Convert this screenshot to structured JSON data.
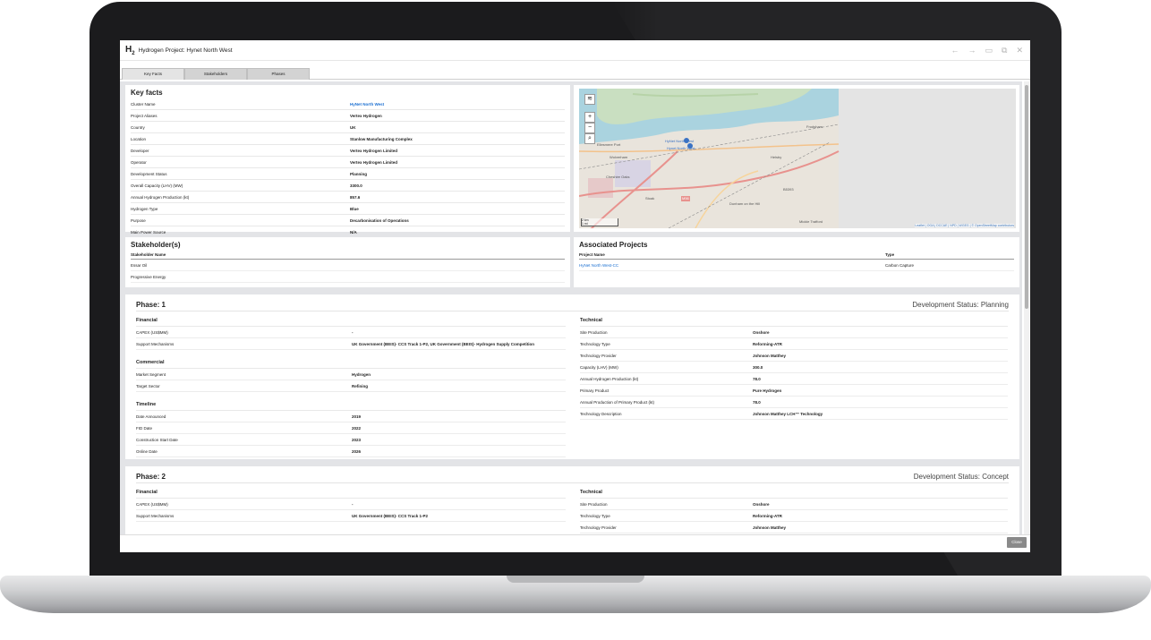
{
  "window": {
    "logo_text": "H",
    "logo_sub": "2",
    "title": "Hydrogen Project: Hynet North West"
  },
  "tabs": [
    "Key Facts",
    "Stakeholders",
    "Phases"
  ],
  "key_facts": {
    "heading": "Key facts",
    "rows": [
      {
        "k": "Cluster Name",
        "v": "HyNet North West"
      },
      {
        "k": "Project Aliases",
        "v": "Vertex Hydrogen"
      },
      {
        "k": "Country",
        "v": "UK"
      },
      {
        "k": "Location",
        "v": "Stanlow Manufacturing Complex"
      },
      {
        "k": "Developer",
        "v": "Vertex Hydrogen Limited"
      },
      {
        "k": "Operator",
        "v": "Vertex Hydrogen Limited"
      },
      {
        "k": "Development Status",
        "v": "Planning"
      },
      {
        "k": "Overall Capacity (LHV) (MW)",
        "v": "3300.0"
      },
      {
        "k": "Annual Hydrogen Production (kt)",
        "v": "857.6"
      },
      {
        "k": "Hydrogen Type",
        "v": "Blue"
      },
      {
        "k": "Purpose",
        "v": "Decarbonisation of Operations"
      },
      {
        "k": "Main Power Source",
        "v": "N/A"
      }
    ]
  },
  "map": {
    "labels": {
      "ellesmere": "Ellesmere Port",
      "hynet1": "HyNet North West",
      "hynet2": "Hynet North West",
      "wolverham": "Wolverham",
      "cheshire": "Cheshire Oaks",
      "frodsham": "Frodsham",
      "helsby": "Helsby",
      "stoak": "Stoak",
      "dunham": "Dunham on the Hill",
      "mickle": "Mickle Trafford",
      "m56": "M56",
      "b5393": "B5393"
    },
    "scale_km": "2 km",
    "scale_mi": "1 mi",
    "attribution": "Leaflet | OGA | DCCAE | NPD | WGEG | © OpenStreetMap contributors",
    "zoom_in": "+",
    "zoom_out": "−"
  },
  "stakeholders": {
    "heading": "Stakeholder(s)",
    "column": "Stakeholder Name",
    "rows": [
      "Essar Oil",
      "Progressive Energy"
    ]
  },
  "associated": {
    "heading": "Associated Projects",
    "col_name": "Project Name",
    "col_type": "Type",
    "rows": [
      {
        "name": "HyNet North West-CC",
        "type": "Carbon Capture"
      }
    ]
  },
  "phase1": {
    "title": "Phase: 1",
    "status": "Development Status: Planning",
    "financial_title": "Financial",
    "financial": [
      {
        "k": "CAPEX (US$MM)",
        "v": "-"
      },
      {
        "k": "Support Mechanisms",
        "v": "UK Government (BEIS)- CCS Track 1-P2, UK Government (BEIS)- Hydrogen Supply Competition"
      }
    ],
    "commercial_title": "Commercial",
    "commercial": [
      {
        "k": "Market Segment",
        "v": "Hydrogen"
      },
      {
        "k": "Target Sector",
        "v": "Refining"
      }
    ],
    "timeline_title": "Timeline",
    "timeline": [
      {
        "k": "Date Announced",
        "v": "2019"
      },
      {
        "k": "FID Date",
        "v": "2022"
      },
      {
        "k": "Construction Start Date",
        "v": "2023"
      },
      {
        "k": "Online Date",
        "v": "2026"
      }
    ],
    "technical_title": "Technical",
    "technical": [
      {
        "k": "Site Production",
        "v": "Onshore"
      },
      {
        "k": "Technology Type",
        "v": "Reforming-ATR"
      },
      {
        "k": "Technology Provider",
        "v": "Johnson Matthey"
      },
      {
        "k": "Capacity (LHV) (MW)",
        "v": "300.0"
      },
      {
        "k": "Annual Hydrogen Production (kt)",
        "v": "78.0"
      },
      {
        "k": "Primary Product",
        "v": "Pure Hydrogen"
      },
      {
        "k": "Annual Production of Primary Product (kt)",
        "v": "78.0"
      },
      {
        "k": "Technology Description",
        "v": "Johnson Matthey LCH™ Technology"
      }
    ]
  },
  "phase2": {
    "title": "Phase: 2",
    "status": "Development Status: Concept",
    "financial_title": "Financial",
    "financial": [
      {
        "k": "CAPEX (US$MM)",
        "v": "-"
      },
      {
        "k": "Support Mechanisms",
        "v": "UK Government (BEIS)- CCS Track 1-P2"
      }
    ],
    "technical_title": "Technical",
    "technical": [
      {
        "k": "Site Production",
        "v": "Onshore"
      },
      {
        "k": "Technology Type",
        "v": "Reforming-ATR"
      },
      {
        "k": "Technology Provider",
        "v": "Johnson Matthey"
      }
    ]
  },
  "footer": {
    "close_label": "Close"
  }
}
